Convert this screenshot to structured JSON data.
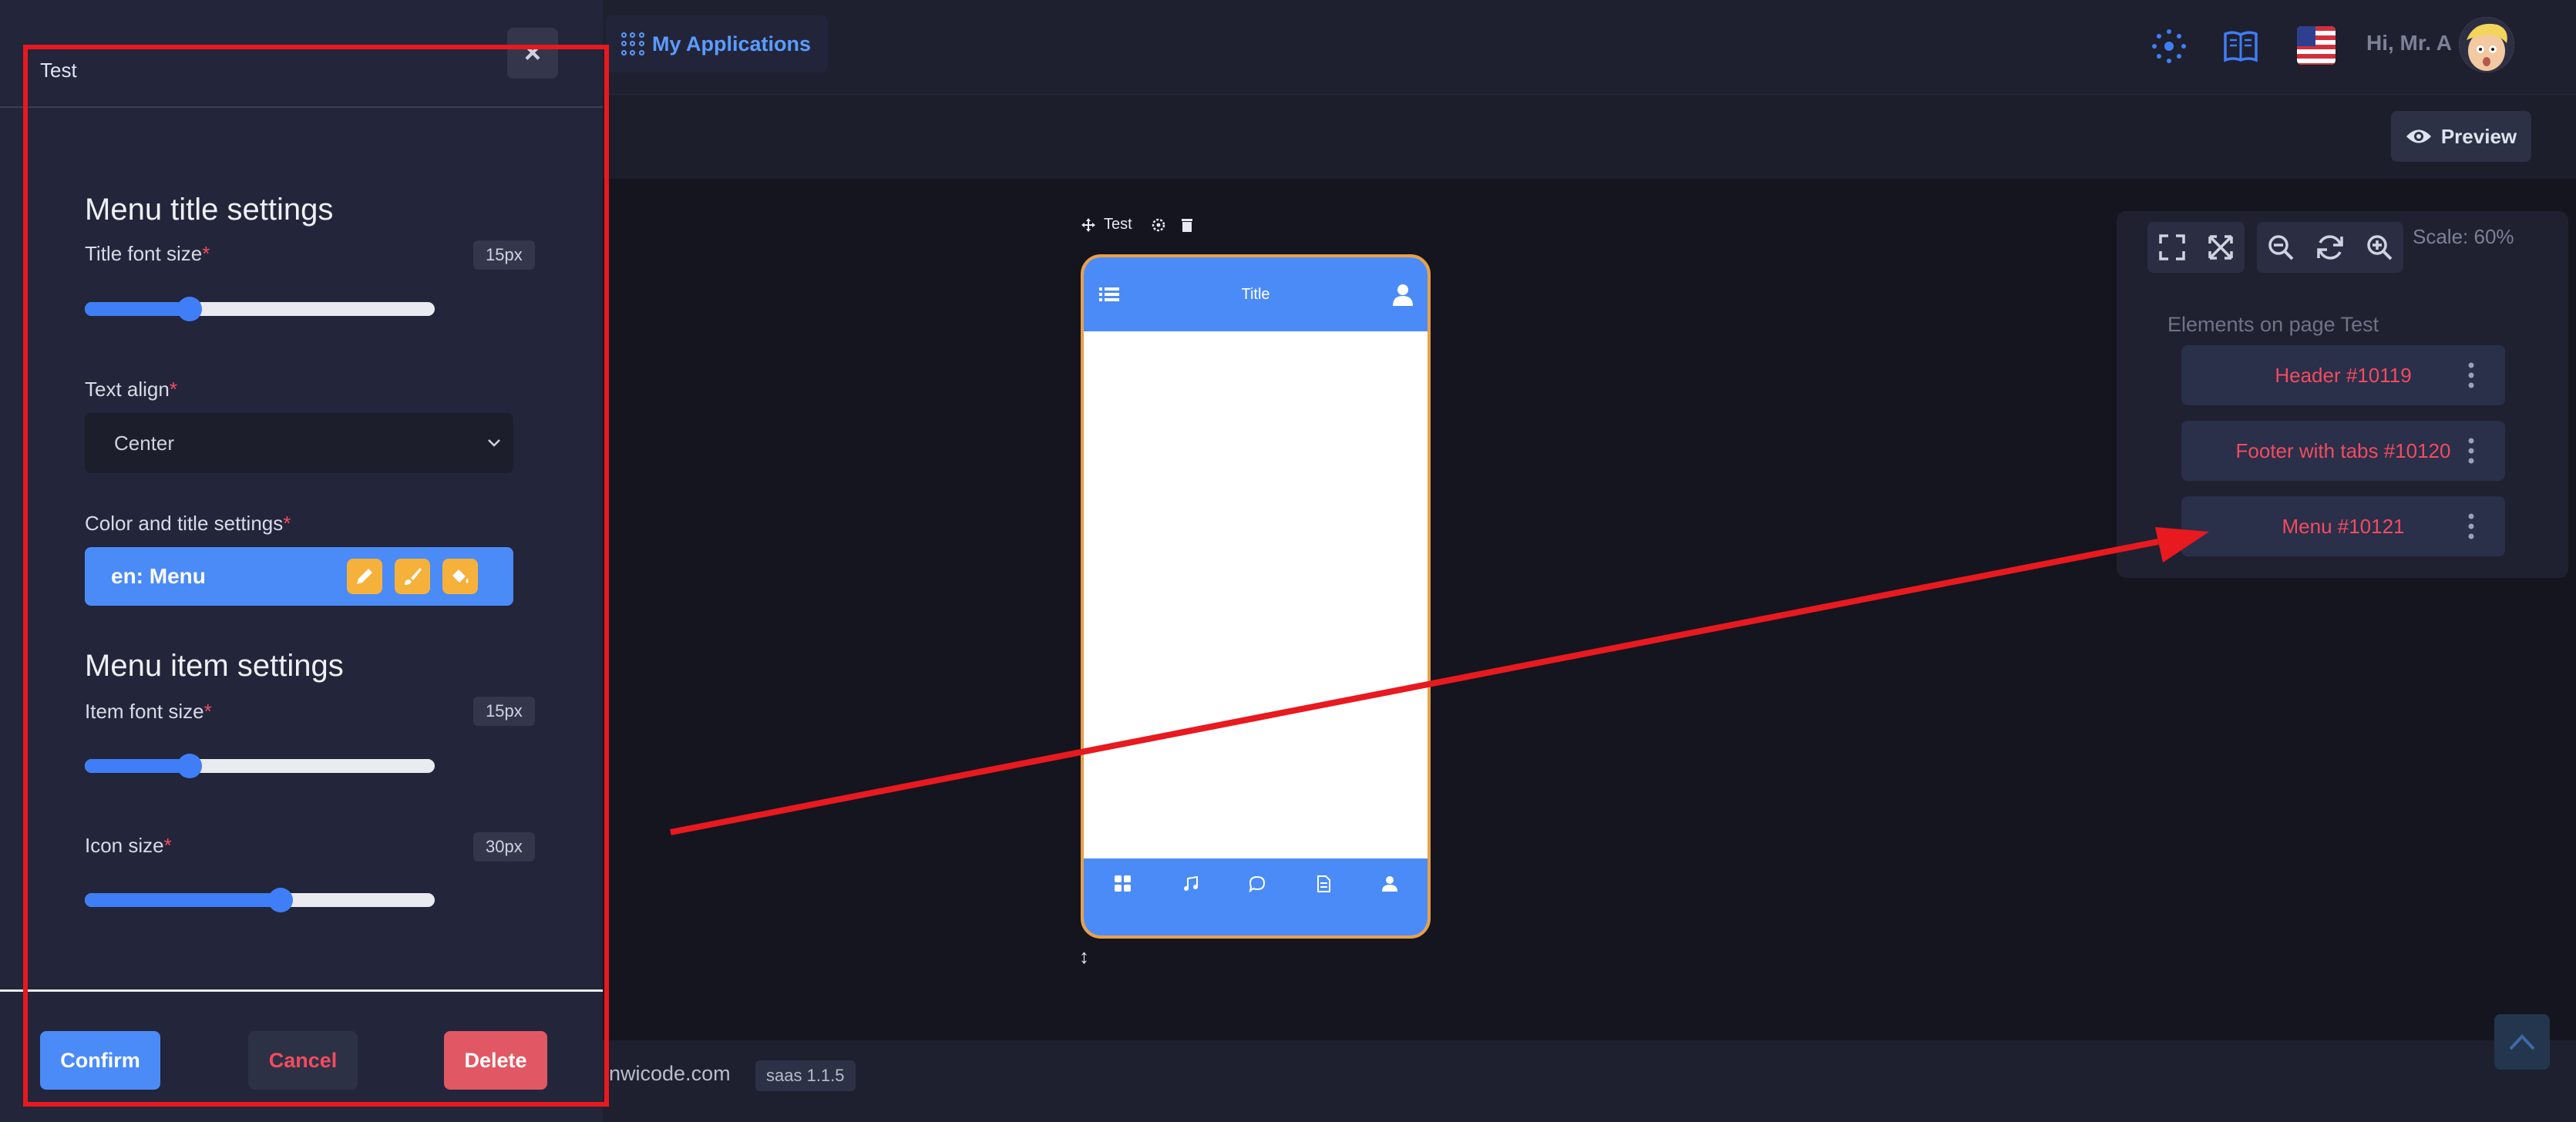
{
  "header": {
    "apps_label": "My Applications",
    "greeting": "Hi, Mr. A"
  },
  "toolbar": {
    "preview_label": "Preview"
  },
  "panel": {
    "title": "Test",
    "close_label": "×",
    "menu_title_heading": "Menu title settings",
    "title_font_size_label": "Title font size",
    "title_font_size_value": "15px",
    "title_font_size_fraction": 0.3,
    "text_align_label": "Text align",
    "text_align_value": "Center",
    "color_title_label": "Color and title settings",
    "color_title_value": "en: Menu",
    "menu_item_heading": "Menu item settings",
    "item_font_size_label": "Item font size",
    "item_font_size_value": "15px",
    "item_font_size_fraction": 0.3,
    "icon_size_label": "Icon size",
    "icon_size_value": "30px",
    "icon_size_fraction": 0.56,
    "required_mark": "*",
    "confirm_label": "Confirm",
    "cancel_label": "Cancel",
    "delete_label": "Delete"
  },
  "footer": {
    "domain": "nwicode.com",
    "version": "saas 1.1.5"
  },
  "phone": {
    "page_label": "Test",
    "header_title": "Title"
  },
  "elements_panel": {
    "scale_label": "Scale: 60%",
    "title": "Elements on page Test",
    "items": [
      {
        "label": "Header #10119"
      },
      {
        "label": "Footer with tabs #10120"
      },
      {
        "label": "Menu #10121"
      }
    ]
  },
  "colors": {
    "accent": "#4b8bf7",
    "danger": "#f34b5f",
    "annotation": "#e8191f",
    "tool_yellow": "#f6b13b"
  }
}
